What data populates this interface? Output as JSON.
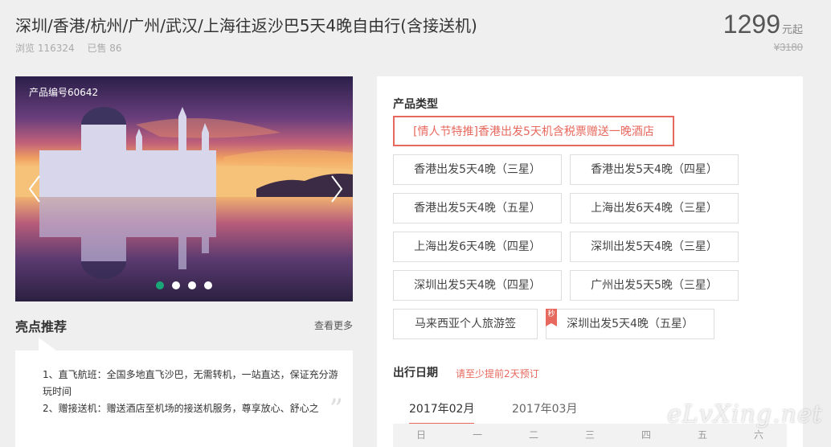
{
  "product": {
    "title": "深圳/香港/杭州/广州/武汉/上海往返沙巴5天4晚自由行(含接送机)",
    "views": "浏览 116324",
    "sold": "已售 86",
    "price": "1299",
    "price_unit": "元起",
    "original_price": "¥3180"
  },
  "carousel": {
    "product_code": "产品编号60642",
    "slide_count": 4,
    "active_slide": 1
  },
  "highlights": {
    "title": "亮点推荐",
    "more_link": "查看更多",
    "items": [
      "1、直飞航班：全国多地直飞沙巴，无需转机，一站直达，保证充分游玩时间",
      "2、赠接送机：赠送酒店至机场的接送机服务，尊享放心、舒心之"
    ]
  },
  "product_type": {
    "label": "产品类型",
    "options": [
      "[情人节特推]香港出发5天机含税票赠送一晚酒店",
      "香港出发5天4晚（三星）",
      "香港出发5天4晚（四星）",
      "香港出发5天4晚（五星）",
      "上海出发6天4晚（三星）",
      "上海出发6天4晚（四星）",
      "深圳出发5天4晚（三星）",
      "深圳出发5天4晚（四星）",
      "广州出发5天5晚（三星）",
      "马来西亚个人旅游签",
      "深圳出发5天4晚（五星）"
    ],
    "selected_index": 0,
    "flash_badge": "秒"
  },
  "departure": {
    "label": "出行日期",
    "hint": "请至少提前2天预订",
    "months": [
      "2017年02月",
      "2017年03月"
    ],
    "active_month": 0,
    "weekdays": [
      "日",
      "一",
      "二",
      "三",
      "四",
      "五",
      "六"
    ]
  },
  "watermark": "eLvXing.net",
  "colors": {
    "accent": "#e7685d",
    "active_dot": "#1aa778",
    "background": "#efefef"
  }
}
